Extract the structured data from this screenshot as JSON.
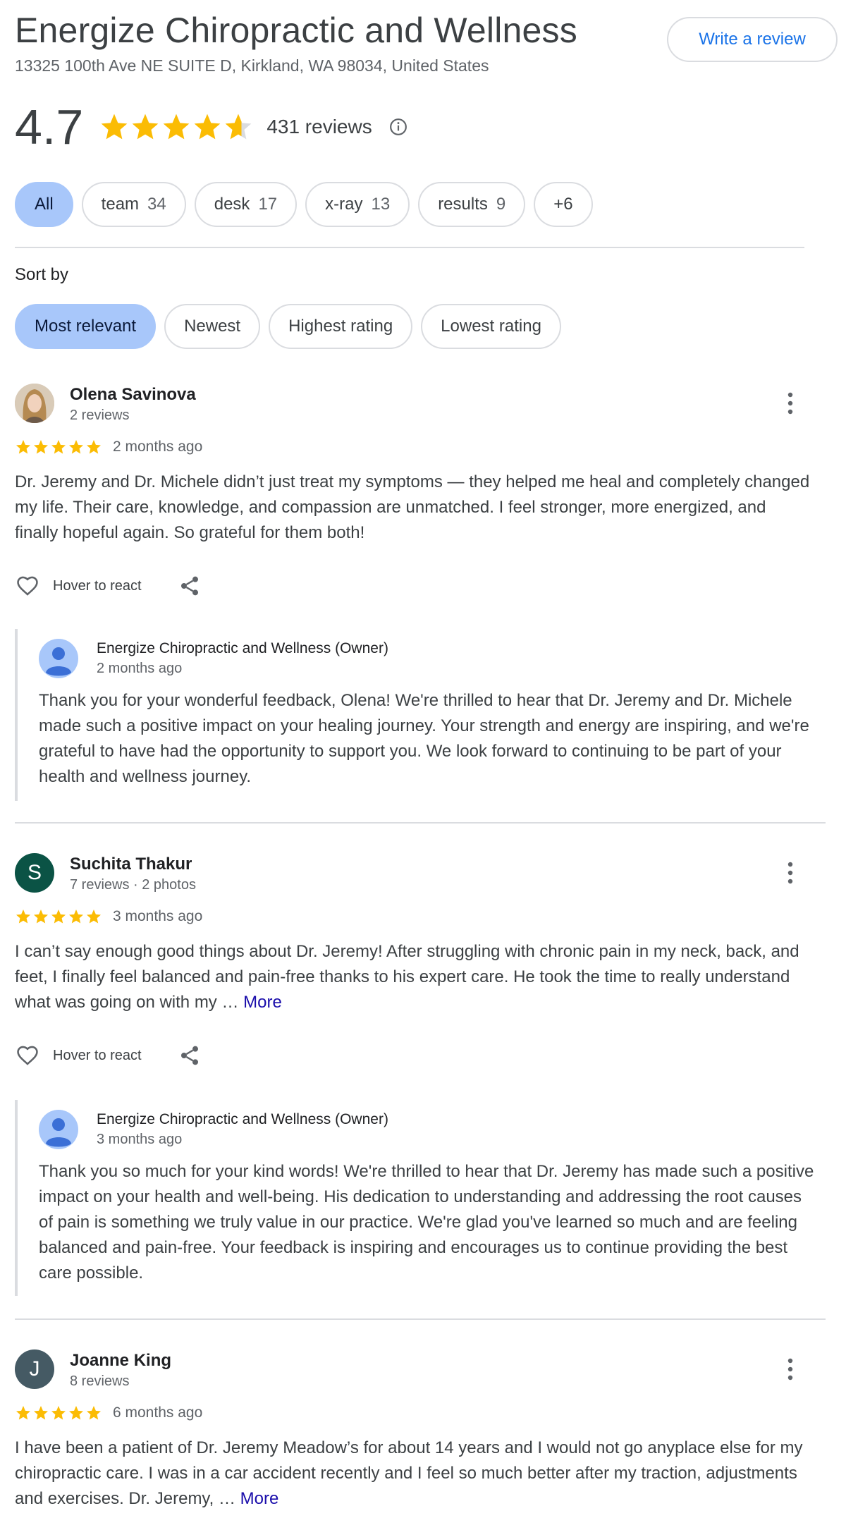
{
  "header": {
    "title": "Energize Chiropractic and Wellness",
    "address": "13325 100th Ave NE SUITE D, Kirkland, WA 98034, United States",
    "write_review_label": "Write a review"
  },
  "summary": {
    "rating": "4.7",
    "rating_value": 4.7,
    "review_count": "431 reviews"
  },
  "topic_chips": [
    {
      "label": "All",
      "count": ""
    },
    {
      "label": "team",
      "count": "34"
    },
    {
      "label": "desk",
      "count": "17"
    },
    {
      "label": "x-ray",
      "count": "13"
    },
    {
      "label": "results",
      "count": "9"
    },
    {
      "label": "+6",
      "count": ""
    }
  ],
  "sort": {
    "label": "Sort by",
    "options": [
      "Most relevant",
      "Newest",
      "Highest rating",
      "Lowest rating"
    ]
  },
  "reviews": [
    {
      "name": "Olena Savinova",
      "meta": "2 reviews",
      "stars": 5,
      "time": "2 months ago",
      "text": "Dr. Jeremy and Dr. Michele didn’t just treat my symptoms — they helped me heal and completely changed my life. Their care, knowledge, and compassion are unmatched. I feel stronger, more energized, and finally hopeful again. So grateful for them both!",
      "more": "",
      "react_label": "Hover to react",
      "owner": {
        "name": "Energize Chiropractic and Wellness (Owner)",
        "time": "2 months ago",
        "text": "Thank you for your wonderful feedback, Olena! We're thrilled to hear that Dr. Jeremy and Dr. Michele made such a positive impact on your healing journey. Your strength and energy are inspiring, and we're grateful to have had the opportunity to support you. We look forward to continuing to be part of your health and wellness journey."
      }
    },
    {
      "name": "Suchita Thakur",
      "initial": "S",
      "meta": "7 reviews · 2 photos",
      "stars": 5,
      "time": "3 months ago",
      "text": "I can’t say enough good things about Dr. Jeremy! After struggling with chronic pain in my neck, back, and feet, I finally feel balanced and pain-free thanks to his expert care. He took the time to really understand what was going on with my … ",
      "more": "More",
      "react_label": "Hover to react",
      "owner": {
        "name": "Energize Chiropractic and Wellness (Owner)",
        "time": "3 months ago",
        "text": "Thank you so much for your kind words! We're thrilled to hear that Dr. Jeremy has made such a positive impact on your health and well-being. His dedication to understanding and addressing the root causes of pain is something we truly value in our practice. We're glad you've learned so much and are feeling balanced and pain-free. Your feedback is inspiring and encourages us to continue providing the best care possible."
      }
    },
    {
      "name": "Joanne King",
      "initial": "J",
      "meta": "8 reviews",
      "stars": 5,
      "time": "6 months ago",
      "text": "I have been a patient of Dr. Jeremy Meadow’s for about 14 years and I would not go anyplace else for my chiropractic care. I was in a car accident recently and I feel so much better after my traction, adjustments and exercises. Dr. Jeremy, … ",
      "more": "More"
    }
  ],
  "colors": {
    "star": "#fbbc04",
    "star_empty": "#dadce0",
    "accent_blue": "#1a73e8",
    "chip_active": "#a8c7fa",
    "avatar_s": "#0b5345",
    "avatar_j": "#455a64",
    "more_link": "#1a0dab"
  },
  "icons": [
    "star-icon",
    "info-icon",
    "more-vert-icon",
    "heart-icon",
    "share-icon",
    "person-avatar-icon"
  ]
}
